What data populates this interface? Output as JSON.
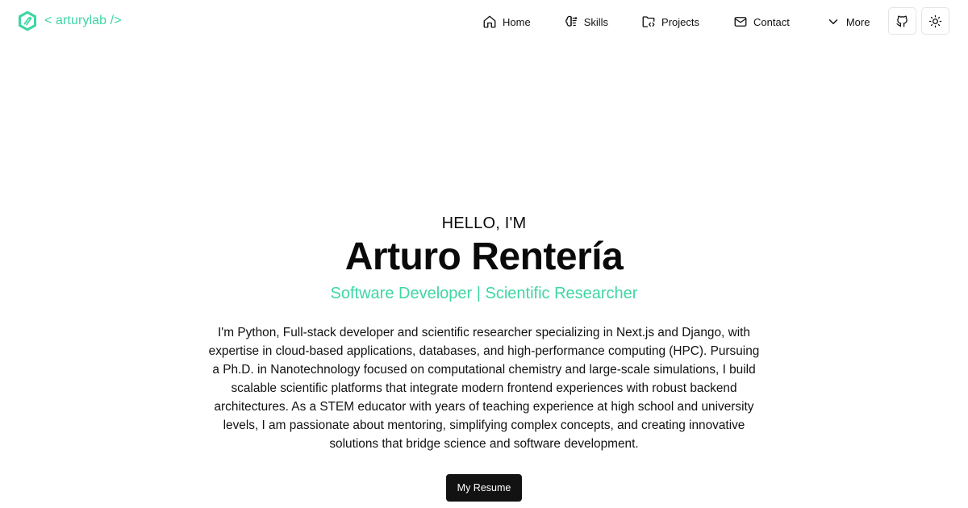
{
  "brand": {
    "text": "< arturylab />",
    "icon": "hexagon-logo-icon",
    "color": "#3ed6a5"
  },
  "nav": {
    "items": [
      {
        "label": "Home",
        "icon": "home-icon"
      },
      {
        "label": "Skills",
        "icon": "brain-icon"
      },
      {
        "label": "Projects",
        "icon": "folder-code-icon"
      },
      {
        "label": "Contact",
        "icon": "mail-icon"
      },
      {
        "label": "More",
        "icon": "chevron-down-icon"
      }
    ],
    "github_icon": "github-icon",
    "theme_icon": "sun-icon"
  },
  "hero": {
    "greeting": "HELLO, I'M",
    "name": "Arturo Rentería",
    "role": "Software Developer | Scientific Researcher",
    "bio": "I'm Python, Full-stack developer and scientific researcher specializing in Next.js and Django, with expertise in cloud-based applications, databases, and high-performance computing (HPC). Pursuing a Ph.D. in Nanotechnology focused on computational chemistry and large-scale simulations, I build scalable scientific platforms that integrate modern frontend experiences with robust backend architectures. As a STEM educator with years of teaching experience at high school and university levels, I am passionate about mentoring, simplifying complex concepts, and creating innovative solutions that bridge science and software development.",
    "resume_label": "My Resume"
  },
  "colors": {
    "accent": "#3ed6a5",
    "button_bg": "#121212",
    "text": "#0a0a0a"
  }
}
